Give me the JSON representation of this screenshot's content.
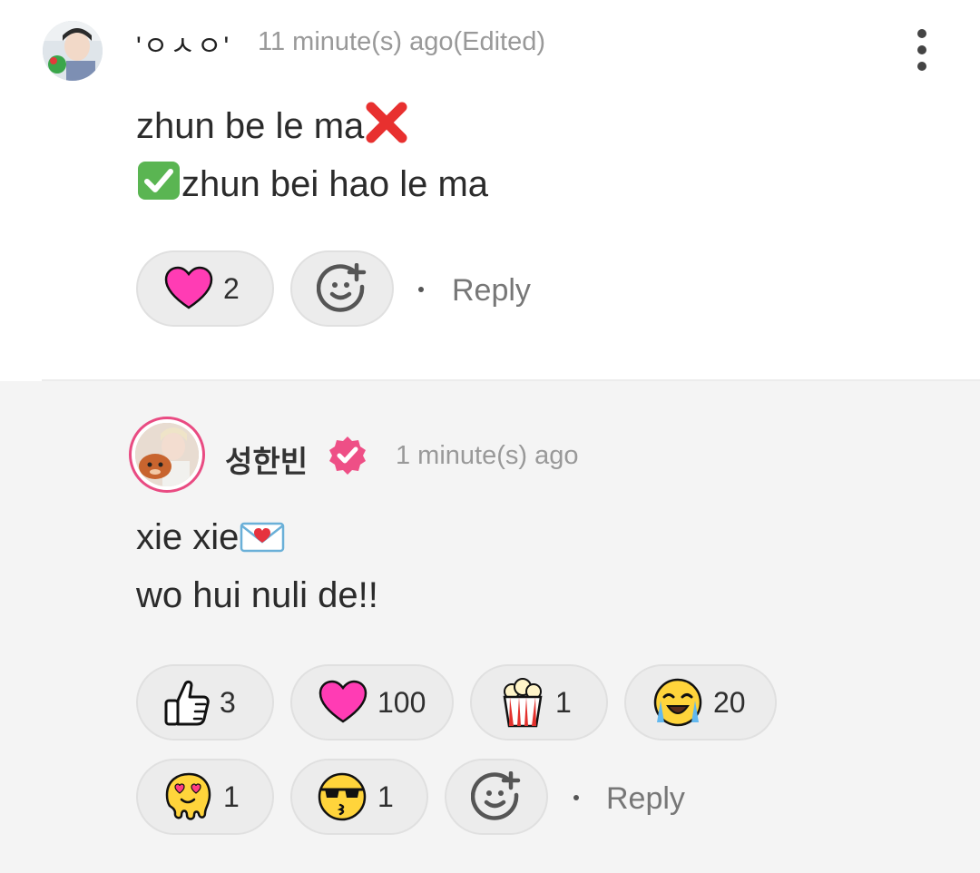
{
  "comment1": {
    "username": "'ㅇㅅㅇ'",
    "time": "11 minute(s) ago(Edited)",
    "lines": [
      "zhun be le ma",
      "zhun bei hao le ma"
    ],
    "line1_emoji": "cross-mark-icon",
    "line2_emoji": "check-mark-icon",
    "reactions": [
      {
        "icon": "heart-icon",
        "count": "2"
      }
    ],
    "reply_label": "Reply"
  },
  "comment2": {
    "username": "성한빈",
    "verified": true,
    "time": "1 minute(s) ago",
    "lines": [
      "xie xie",
      "wo hui nuli de!!"
    ],
    "line1_emoji": "love-letter-icon",
    "reactions": [
      {
        "icon": "thumbs-up-icon",
        "count": "3"
      },
      {
        "icon": "heart-icon",
        "count": "100"
      },
      {
        "icon": "popcorn-icon",
        "count": "1"
      },
      {
        "icon": "crying-face-icon",
        "count": "20"
      },
      {
        "icon": "melting-heart-eyes-icon",
        "count": "1"
      },
      {
        "icon": "sunglasses-kiss-icon",
        "count": "1"
      }
    ],
    "reply_label": "Reply"
  },
  "colors": {
    "accent_pink": "#e94b82",
    "heart": "#ff3cb4",
    "divider": "#ececec",
    "reply_bg": "#f4f4f4"
  }
}
